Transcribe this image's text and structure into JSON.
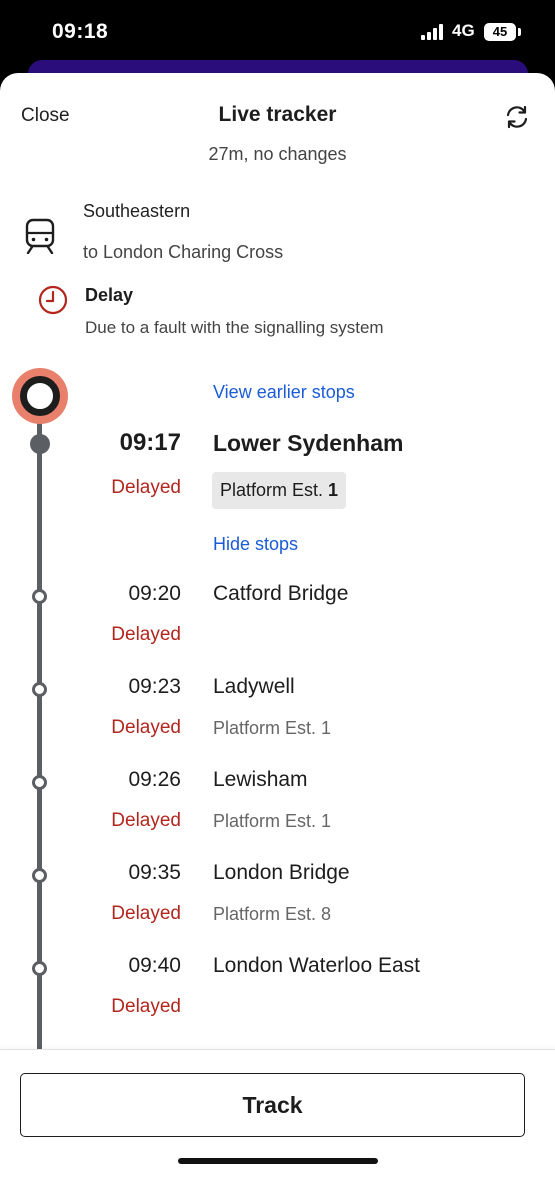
{
  "status_bar": {
    "time": "09:18",
    "network": "4G",
    "battery": "45"
  },
  "header": {
    "close_label": "Close",
    "title": "Live tracker",
    "subtitle": "27m, no changes"
  },
  "service": {
    "operator": "Southeastern",
    "destination": "to London Charing Cross",
    "icon": "train-icon"
  },
  "alert": {
    "title": "Delay",
    "reason": "Due to a fault with the signalling system",
    "icon": "clock-icon",
    "color": "#b3261e"
  },
  "links": {
    "view_earlier": "View earlier stops",
    "hide_stops": "Hide stops"
  },
  "current_stop": {
    "time": "09:17",
    "status": "Delayed",
    "station": "Lower Sydenham",
    "platform_prefix": "Platform Est.",
    "platform_number": "1"
  },
  "stops": [
    {
      "time": "09:20",
      "status": "Delayed",
      "station": "Catford Bridge",
      "platform": ""
    },
    {
      "time": "09:23",
      "status": "Delayed",
      "station": "Ladywell",
      "platform": "Platform Est. 1"
    },
    {
      "time": "09:26",
      "status": "Delayed",
      "station": "Lewisham",
      "platform": "Platform Est. 1"
    },
    {
      "time": "09:35",
      "status": "Delayed",
      "station": "London Bridge",
      "platform": "Platform Est. 8"
    },
    {
      "time": "09:40",
      "status": "Delayed",
      "station": "London Waterloo East",
      "platform": ""
    }
  ],
  "footer": {
    "track_label": "Track"
  },
  "colors": {
    "link": "#1a5bd6",
    "delay": "#b3261e",
    "marker": "#e8806b",
    "line": "#5b5f63"
  }
}
